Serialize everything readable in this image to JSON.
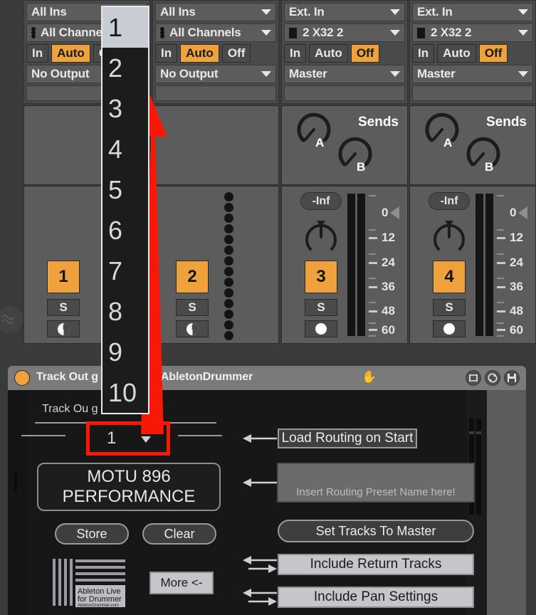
{
  "mixer": {
    "tracks": [
      {
        "audio_from": "All Ins",
        "input_channel": "All Channels",
        "channel_icon": "dots",
        "monitor": {
          "in": "In",
          "auto": "Auto",
          "off": "Off",
          "active": "Auto"
        },
        "audio_to": "No Output",
        "output_channel": "",
        "has_sends": false,
        "has_fader": false,
        "meter_style": "none",
        "number": "1",
        "solo": "S",
        "arm_icon": "midi-arm-icon"
      },
      {
        "audio_from": "All Ins",
        "input_channel": "All Channels",
        "channel_icon": "dots",
        "monitor": {
          "in": "In",
          "auto": "Auto",
          "off": "Off",
          "active": "Auto"
        },
        "audio_to": "No Output",
        "output_channel": "",
        "has_sends": false,
        "has_fader": false,
        "meter_style": "dots",
        "number": "2",
        "solo": "S",
        "arm_icon": "midi-arm-icon"
      },
      {
        "audio_from": "Ext. In",
        "input_channel": "2 X32 2",
        "channel_icon": "square",
        "monitor": {
          "in": "In",
          "auto": "Auto",
          "off": "Off",
          "active": "Off"
        },
        "audio_to": "Master",
        "output_channel": "",
        "has_sends": true,
        "sends_label": "Sends",
        "send_a": "A",
        "send_b": "B",
        "has_fader": true,
        "volume": "-Inf",
        "meter_style": "bars",
        "number": "3",
        "solo": "S",
        "arm_icon": "record-arm-icon"
      },
      {
        "audio_from": "Ext. In",
        "input_channel": "2 X32 2",
        "channel_icon": "square",
        "monitor": {
          "in": "In",
          "auto": "Auto",
          "off": "Off",
          "active": "Off"
        },
        "audio_to": "Master",
        "output_channel": "",
        "has_sends": true,
        "sends_label": "Sends",
        "send_a": "A",
        "send_b": "B",
        "has_fader": true,
        "volume": "-Inf",
        "meter_style": "bars",
        "number": "4",
        "solo": "S",
        "arm_icon": "record-arm-icon"
      }
    ],
    "meter_scale": [
      "0",
      "12",
      "24",
      "36",
      "48",
      "60"
    ]
  },
  "dropdown": {
    "open": true,
    "selected": "1",
    "options": [
      "1",
      "2",
      "3",
      "4",
      "5",
      "6",
      "7",
      "8",
      "9",
      "10"
    ]
  },
  "device": {
    "power_state": "on",
    "title": "Track Output Routing Recall V1 - AbletonDrummer",
    "title_visible": "Track Out       g Recall V1 - AbletonDrummer",
    "hand_icon": "hand-icon",
    "bar_icons": [
      "map-icon",
      "sync-icon",
      "save-icon"
    ],
    "section_label": "Track Output Routing Recall",
    "section_label_visible": "Track Ou        g Recall",
    "preset_slot": "1",
    "preset_name_line1": "MOTU 896",
    "preset_name_line2": "PERFORMANCE",
    "store_label": "Store",
    "clear_label": "Clear",
    "more_label": "More <-",
    "load_on_start_label": "Load Routing on Start",
    "name_input_placeholder": "Insert Routing Preset Name here!",
    "name_input_value": "",
    "set_tracks_label": "Set Tracks To Master",
    "include_return_label": "Include Return Tracks",
    "include_pan_label": "Include Pan Settings",
    "logo_line1": "Ableton Live",
    "logo_line2": "for Drummer",
    "logo_line3": "AbletonDrummer.com"
  },
  "annotation": {
    "arrow_color": "#f81808",
    "highlight_color": "#f81808",
    "arrow_direction": "up"
  },
  "colors": {
    "accent_orange": "#efa13c",
    "mixer_bg": "#3b3b3b",
    "track_bg": "#5c5c5c",
    "device_bg": "#171717",
    "device_bar": "#7a7a7a"
  }
}
